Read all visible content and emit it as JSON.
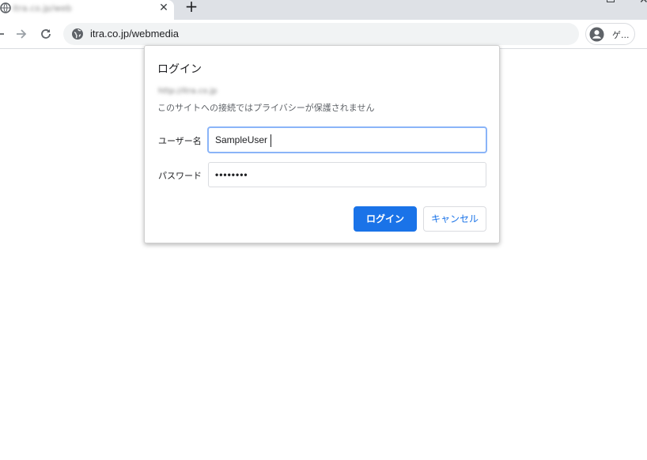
{
  "browser": {
    "tab": {
      "title": "itra.co.jp/webmedia",
      "close_glyph": "✕",
      "favicon": "globe-icon"
    },
    "new_tab_glyph": "+",
    "toolbar": {
      "back_icon": "back-arrow-icon",
      "forward_icon": "forward-arrow-icon",
      "reload_icon": "reload-icon",
      "url": "itra.co.jp/webmedia",
      "site_info_icon": "globe-icon",
      "profile": {
        "label": "ゲ...",
        "icon": "avatar-icon"
      }
    }
  },
  "auth_dialog": {
    "title": "ログイン",
    "origin": "http://itra.co.jp",
    "warning": "このサイトへの接続ではプライバシーが保護されません",
    "username_label": "ユーザー名",
    "username_value": "SampleUser",
    "password_label": "パスワード",
    "password_value": "••••••••",
    "login_button": "ログイン",
    "cancel_button": "キャンセル"
  },
  "colors": {
    "accent": "#1a73e8",
    "tabstrip": "#dee1e6",
    "omnibox": "#f1f3f4",
    "focus_ring": "#8ab4f8"
  }
}
